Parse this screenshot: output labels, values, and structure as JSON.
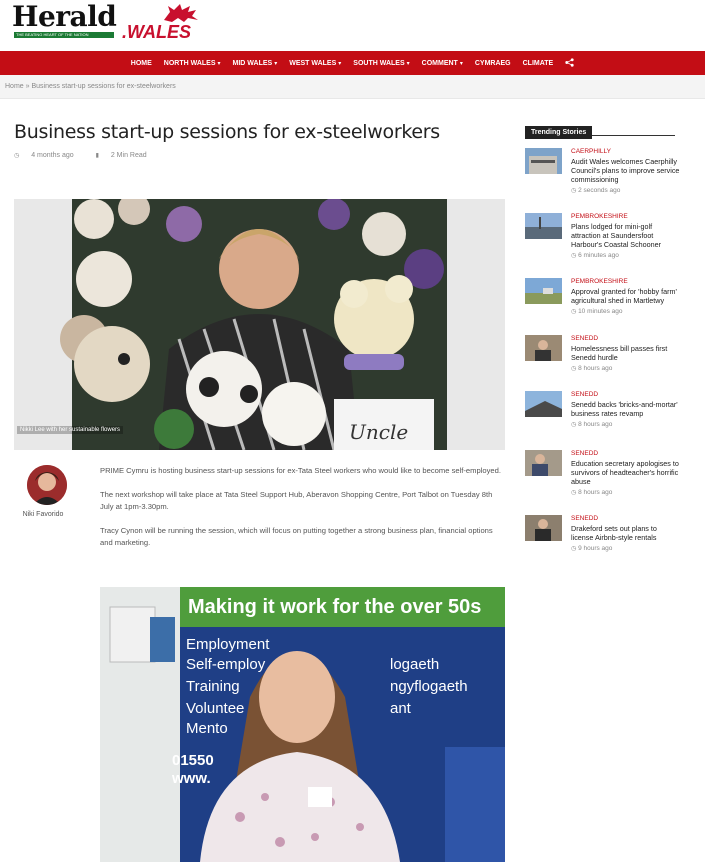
{
  "brand": {
    "name": "Herald",
    "sub": ".WALES",
    "tagline": "THE BEATING HEART OF THE NATION"
  },
  "nav": {
    "items": [
      {
        "label": "HOME",
        "dropdown": false
      },
      {
        "label": "NORTH WALES",
        "dropdown": true
      },
      {
        "label": "MID WALES",
        "dropdown": true
      },
      {
        "label": "WEST WALES",
        "dropdown": true
      },
      {
        "label": "SOUTH WALES",
        "dropdown": true
      },
      {
        "label": "COMMENT",
        "dropdown": true
      },
      {
        "label": "CYMRAEG",
        "dropdown": false
      },
      {
        "label": "CLIMATE",
        "dropdown": false
      }
    ],
    "share_icon": "share-icon"
  },
  "breadcrumb": "Home » Business start-up sessions for ex-steelworkers",
  "article": {
    "title": "Business start-up sessions for ex-steelworkers",
    "posted": "4 months ago",
    "read_time": "2 Min Read",
    "hero_caption": "Nikki Lee with her sustainable flowers",
    "author": "Niki Favorido",
    "paragraphs": [
      "PRIME Cymru is hosting business start-up sessions for ex-Tata Steel workers who would like to become self-employed.",
      "The next workshop will take place at Tata Steel Support Hub, Aberavon Shopping Centre, Port Talbot on Tuesday 8th July at 1pm-3.30pm.",
      "Tracy Cynon will be running the session, which will focus on putting together a strong business plan, financial options and marketing."
    ],
    "banner_text": {
      "headline": "Making it work for the over 50s",
      "lines": [
        "Employment",
        "Self-employ",
        "Training",
        "Voluntee",
        "Mento"
      ],
      "welsh": [
        "logaeth",
        "ngyflogaeth",
        "ant"
      ],
      "phone": "01550",
      "web": "www."
    }
  },
  "sidebar": {
    "heading": "Trending Stories",
    "stories": [
      {
        "category": "CAERPHILLY",
        "headline": "Audit Wales welcomes Caerphilly Council's plans to improve service commissioning",
        "time": "2 seconds ago"
      },
      {
        "category": "PEMBROKESHIRE",
        "headline": "Plans lodged for mini-golf attraction at Saundersfoot Harbour's Coastal Schooner",
        "time": "6 minutes ago"
      },
      {
        "category": "PEMBROKESHIRE",
        "headline": "Approval granted for 'hobby farm' agricultural shed in Martletwy",
        "time": "10 minutes ago"
      },
      {
        "category": "SENEDD",
        "headline": "Homelessness bill passes first Senedd hurdle",
        "time": "8 hours ago"
      },
      {
        "category": "SENEDD",
        "headline": "Senedd backs 'bricks-and-mortar' business rates revamp",
        "time": "8 hours ago"
      },
      {
        "category": "SENEDD",
        "headline": "Education secretary apologises to survivors of headteacher's horrific abuse",
        "time": "8 hours ago"
      },
      {
        "category": "SENEDD",
        "headline": "Drakeford sets out plans to license Airbnb-style rentals",
        "time": "9 hours ago"
      }
    ]
  },
  "colors": {
    "accent": "#c30d15",
    "brand_green": "#1b7a34"
  }
}
